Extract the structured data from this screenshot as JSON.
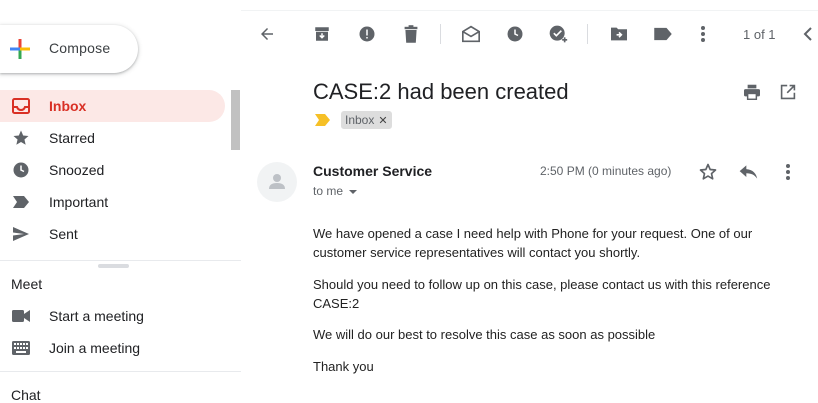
{
  "sidebar": {
    "compose_label": "Compose",
    "items": [
      {
        "label": "Inbox",
        "icon": "inbox-icon",
        "active": true
      },
      {
        "label": "Starred",
        "icon": "star-icon"
      },
      {
        "label": "Snoozed",
        "icon": "clock-icon"
      },
      {
        "label": "Important",
        "icon": "important-icon"
      },
      {
        "label": "Sent",
        "icon": "send-icon"
      }
    ]
  },
  "meet": {
    "title": "Meet",
    "start": "Start a meeting",
    "join": "Join a meeting"
  },
  "chat": {
    "title": "Chat"
  },
  "toolbar": {
    "pager": "1 of 1"
  },
  "message": {
    "subject": "CASE:2 had been created",
    "label_chip": "Inbox",
    "sender": "Customer Service",
    "recipient": "to me",
    "time": "2:50 PM (0 minutes ago)",
    "paragraphs": [
      "We have opened a case I need help with Phone for your request. One of our customer service representatives will contact you shortly.",
      "Should you need to follow up on this case, please contact us with this reference CASE:2",
      "We will do our best to resolve this case as soon as possible",
      "Thank you"
    ]
  },
  "colors": {
    "accent_red": "#d93025",
    "active_bg": "#fce8e6",
    "icon_gray": "#5f6368",
    "label_yellow": "#f6c026"
  }
}
